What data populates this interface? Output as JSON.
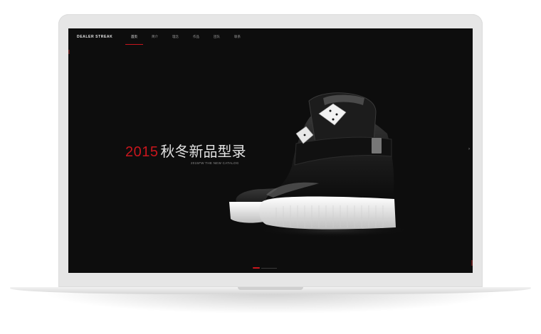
{
  "site": {
    "brand": "DEALER STREAK",
    "nav": [
      {
        "label": "首页",
        "active": true
      },
      {
        "label": "简介",
        "active": false
      },
      {
        "label": "理念",
        "active": false
      },
      {
        "label": "作品",
        "active": false
      },
      {
        "label": "团队",
        "active": false
      },
      {
        "label": "联系",
        "active": false
      }
    ]
  },
  "hero": {
    "year": "2015",
    "title": "秋冬新品型录",
    "subtitle": "2015FW THE NEW CATALOG",
    "image": "black-high-top-sneaker-with-dice"
  },
  "colors": {
    "accent": "#c8161d",
    "background": "#0d0d0d",
    "frame": "#e6e6e6"
  }
}
